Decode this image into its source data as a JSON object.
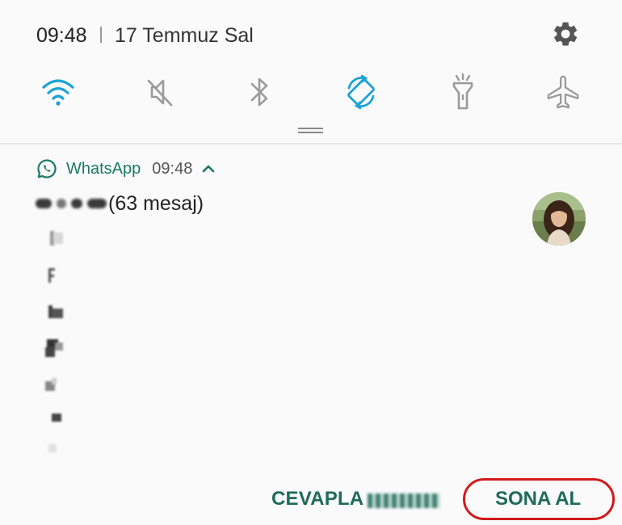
{
  "status_bar": {
    "time": "09:48",
    "date": "17 Temmuz Sal",
    "settings_icon": "gear-icon"
  },
  "quick_settings": [
    {
      "name": "wifi",
      "icon": "wifi-icon",
      "active": true
    },
    {
      "name": "sound",
      "icon": "mute-icon",
      "active": false
    },
    {
      "name": "bluetooth",
      "icon": "bluetooth-icon",
      "active": false
    },
    {
      "name": "auto-rotate",
      "icon": "rotate-icon",
      "active": true
    },
    {
      "name": "flashlight",
      "icon": "flashlight-icon",
      "active": false
    },
    {
      "name": "airplane",
      "icon": "airplane-icon",
      "active": false
    }
  ],
  "notification": {
    "app_name": "WhatsApp",
    "time": "09:48",
    "message_count": "(63 mesaj)",
    "actions": {
      "reply": "CEVAPLA",
      "end": "SONA AL"
    }
  },
  "colors": {
    "accent": "#1ba3d6",
    "whatsapp_green": "#1a7a64",
    "action_text": "#1f6a5a",
    "highlight_ring": "#d11a1a",
    "icon_inactive": "#9a9a9a"
  }
}
